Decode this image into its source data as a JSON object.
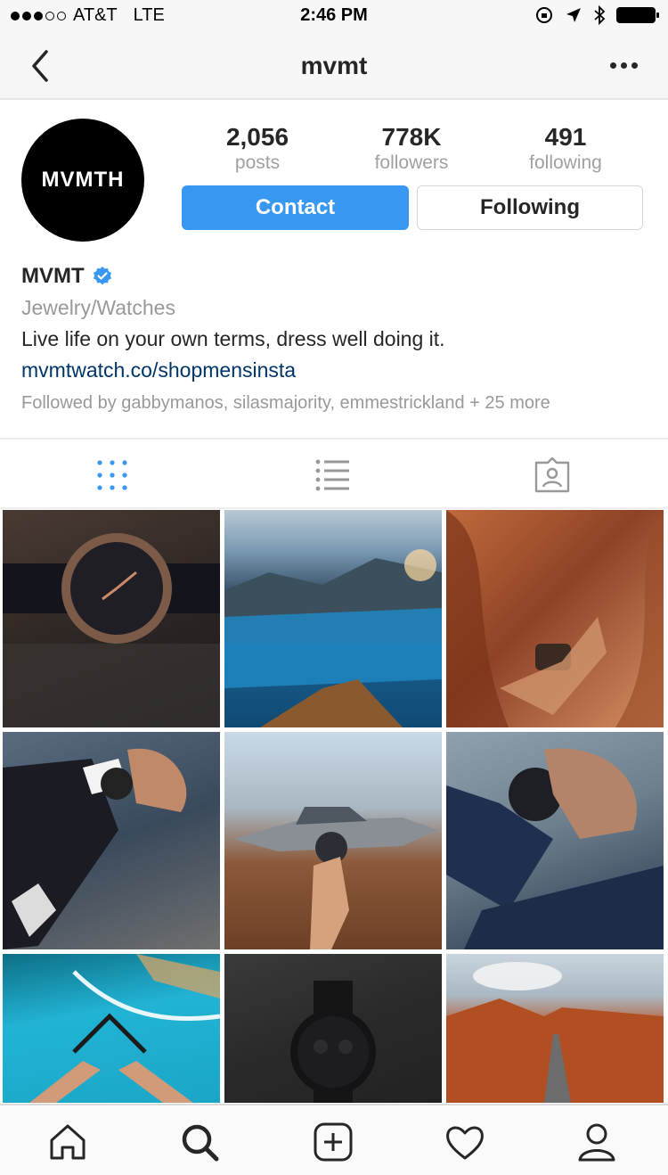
{
  "status_bar": {
    "carrier": "AT&T",
    "network": "LTE",
    "time": "2:46 PM"
  },
  "nav": {
    "title": "mvmt"
  },
  "profile": {
    "avatar_text": "MVMTH",
    "stats": [
      {
        "value": "2,056",
        "label": "posts"
      },
      {
        "value": "778K",
        "label": "followers"
      },
      {
        "value": "491",
        "label": "following"
      }
    ],
    "contact_label": "Contact",
    "following_label": "Following",
    "name": "MVMT",
    "category": "Jewelry/Watches",
    "bio": "Live life on your own terms, dress well doing it.",
    "link": "mvmtwatch.co/shopmensinsta",
    "followed_by": "Followed by gabbymanos, silasmajority, emmestrickland + 25 more"
  },
  "tabs": [
    "grid-view",
    "list-view",
    "tagged-view"
  ],
  "posts": [
    "watch-on-leather",
    "mountain-lake",
    "canyon-hand",
    "suit-wrist-watch",
    "airplane-watch",
    "jacket-wrist-watch",
    "boat-wake",
    "black-watch",
    "desert-road"
  ],
  "colors": {
    "accent": "#3897f0",
    "link": "#003569",
    "muted": "#999999",
    "text": "#262626"
  }
}
